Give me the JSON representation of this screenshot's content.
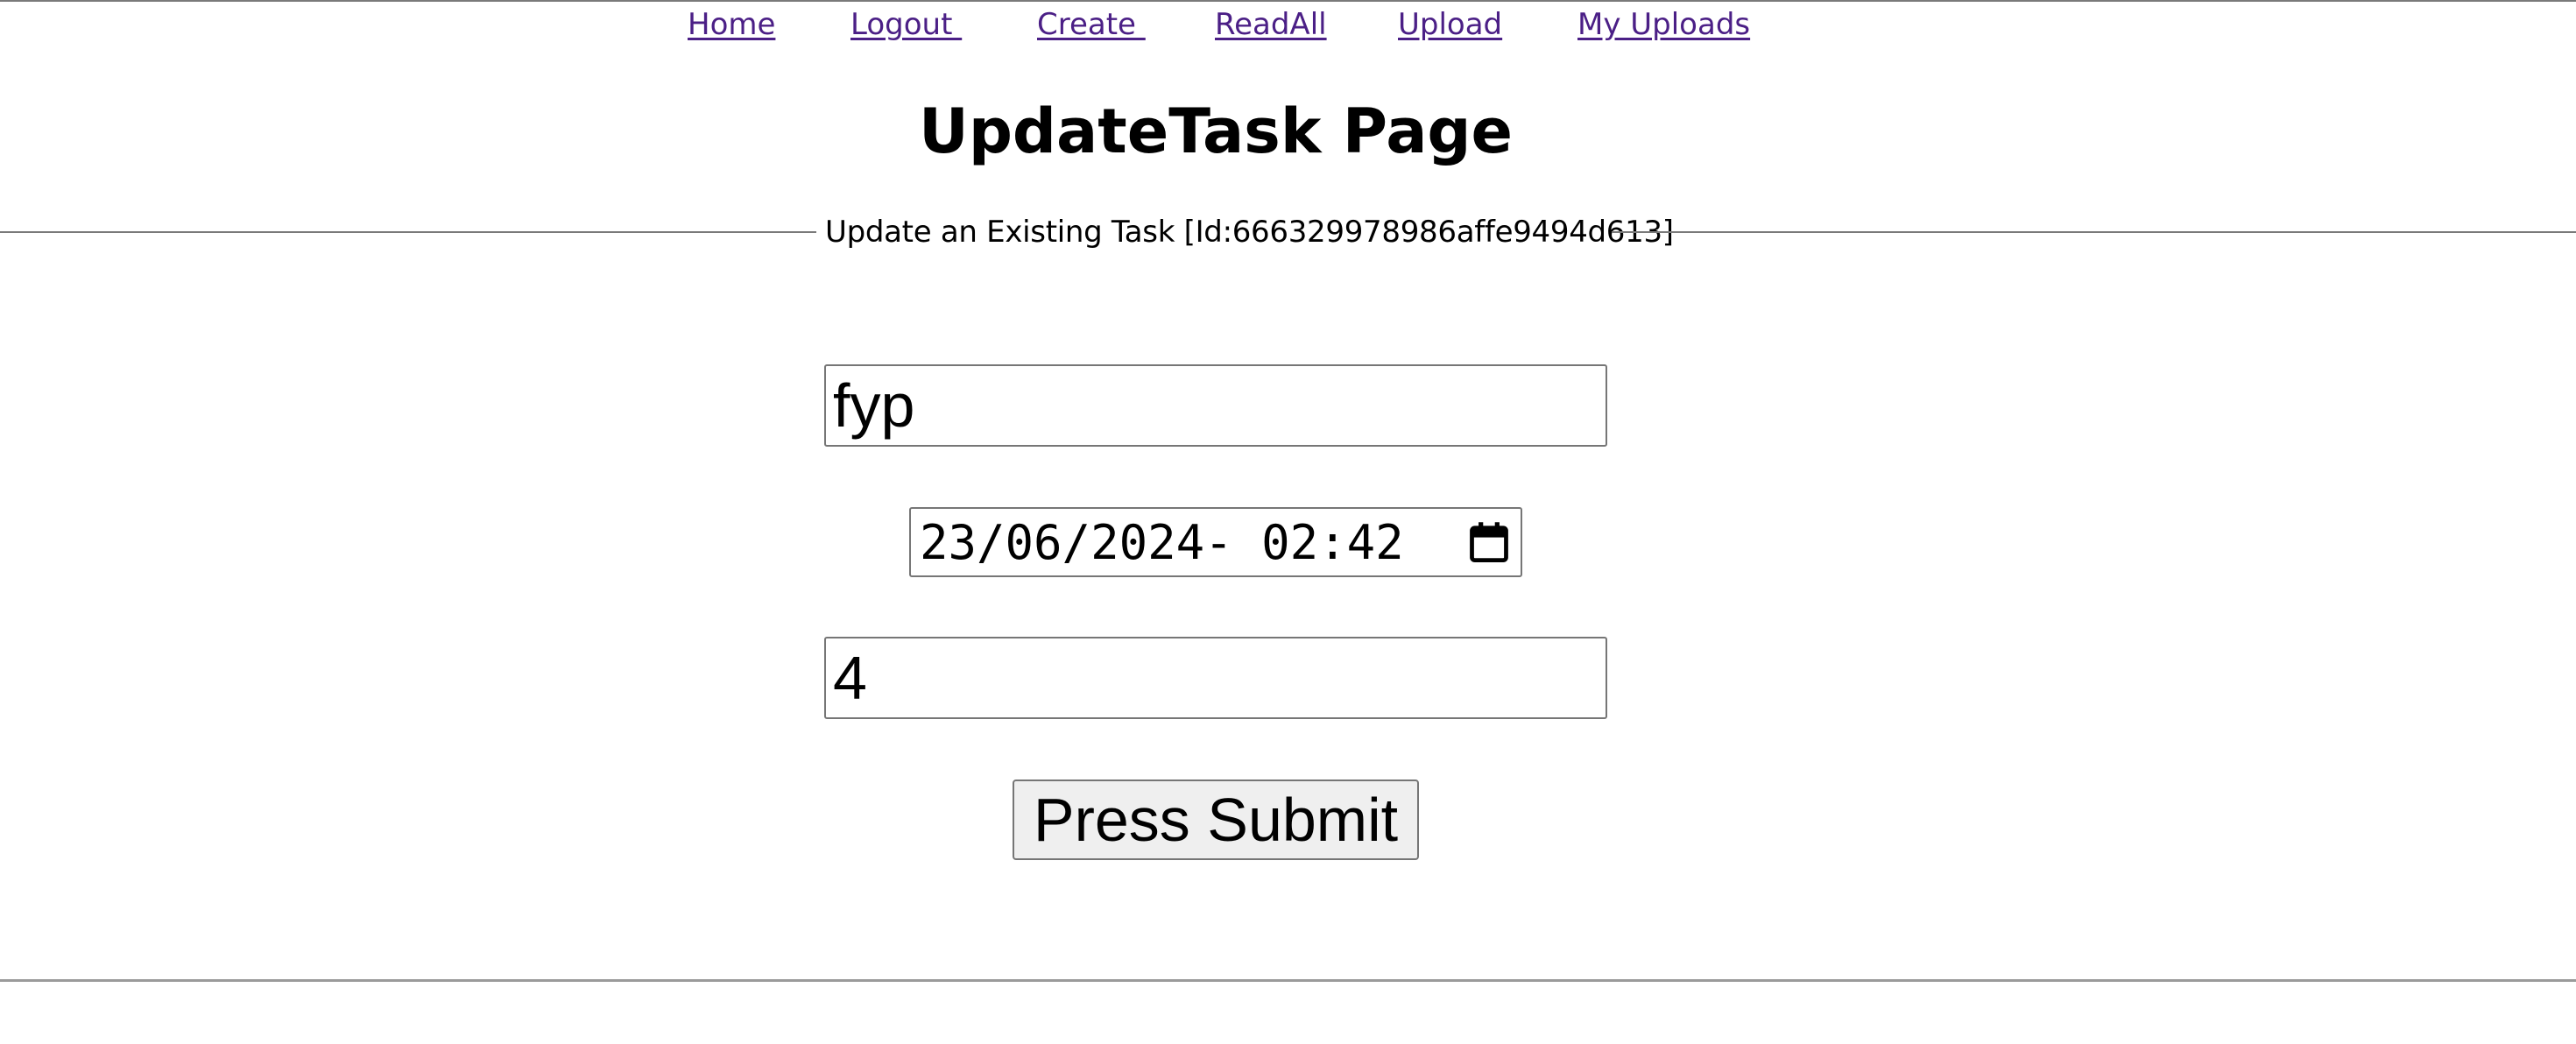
{
  "nav": {
    "items": [
      {
        "label": "Home"
      },
      {
        "label": "Logout "
      },
      {
        "label": "Create "
      },
      {
        "label": "ReadAll"
      },
      {
        "label": "Upload"
      },
      {
        "label": "My Uploads"
      }
    ],
    "link_color": "#4b1f86"
  },
  "page": {
    "title": "UpdateTask Page"
  },
  "form": {
    "legend": "Update an Existing Task [Id:666329978986affe9494d613]",
    "task_name_value": "fyp",
    "due_datetime_value": "23/06/2024- 02:42",
    "duration_value": "4",
    "submit_label": "Press Submit",
    "date_picker_icon": "calendar-icon"
  },
  "colors": {
    "rule": "#7a7a7a",
    "button_bg": "#efefef",
    "input_border": "#767676"
  }
}
